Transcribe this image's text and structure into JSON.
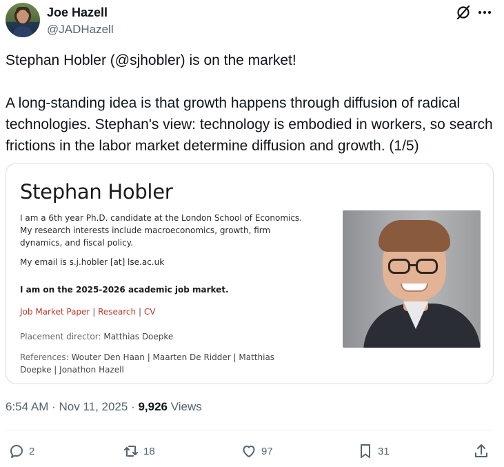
{
  "author": {
    "name": "Joe Hazell",
    "handle": "@JADHazell"
  },
  "tweet": {
    "line1": "Stephan Hobler (@sjhobler) is on the market!",
    "line2": "A long-standing idea is that growth happens through diffusion of radical technologies. Stephan's view: technology is embodied in workers, so search frictions in the labor market determine diffusion and growth. (1/5)"
  },
  "card": {
    "title": "Stephan Hobler",
    "intro": "I am a 6th year Ph.D. candidate at the London School of Economics. My research interests include macroeconomics, growth, firm dynamics, and fiscal policy.",
    "email": "My email is s.j.hobler [at] lse.ac.uk",
    "market": "I am on the 2025-2026 academic job market.",
    "links": [
      "Job Market Paper",
      "Research",
      "CV"
    ],
    "link_sep": "|",
    "placement_label": "Placement director:",
    "placement_name": "Matthias Doepke",
    "refs_label": "References:",
    "refs_names": "Wouter Den Haan | Maarten De Ridder | Matthias Doepke | Jonathon Hazell"
  },
  "meta": {
    "time": "6:54 AM · Nov 11, 2025 · ",
    "views_count": "9,926",
    "views_label": " Views"
  },
  "actions": {
    "replies": "2",
    "reposts": "18",
    "likes": "97",
    "bookmarks": "31"
  },
  "icons": {
    "grok": "grok-icon",
    "more": "more-icon",
    "reply": "reply-icon",
    "repost": "repost-icon",
    "like": "heart-icon",
    "bookmark": "bookmark-icon",
    "share": "share-icon"
  },
  "colors": {
    "text": "#0f1419",
    "muted": "#536471",
    "link_red": "#c0392b"
  }
}
